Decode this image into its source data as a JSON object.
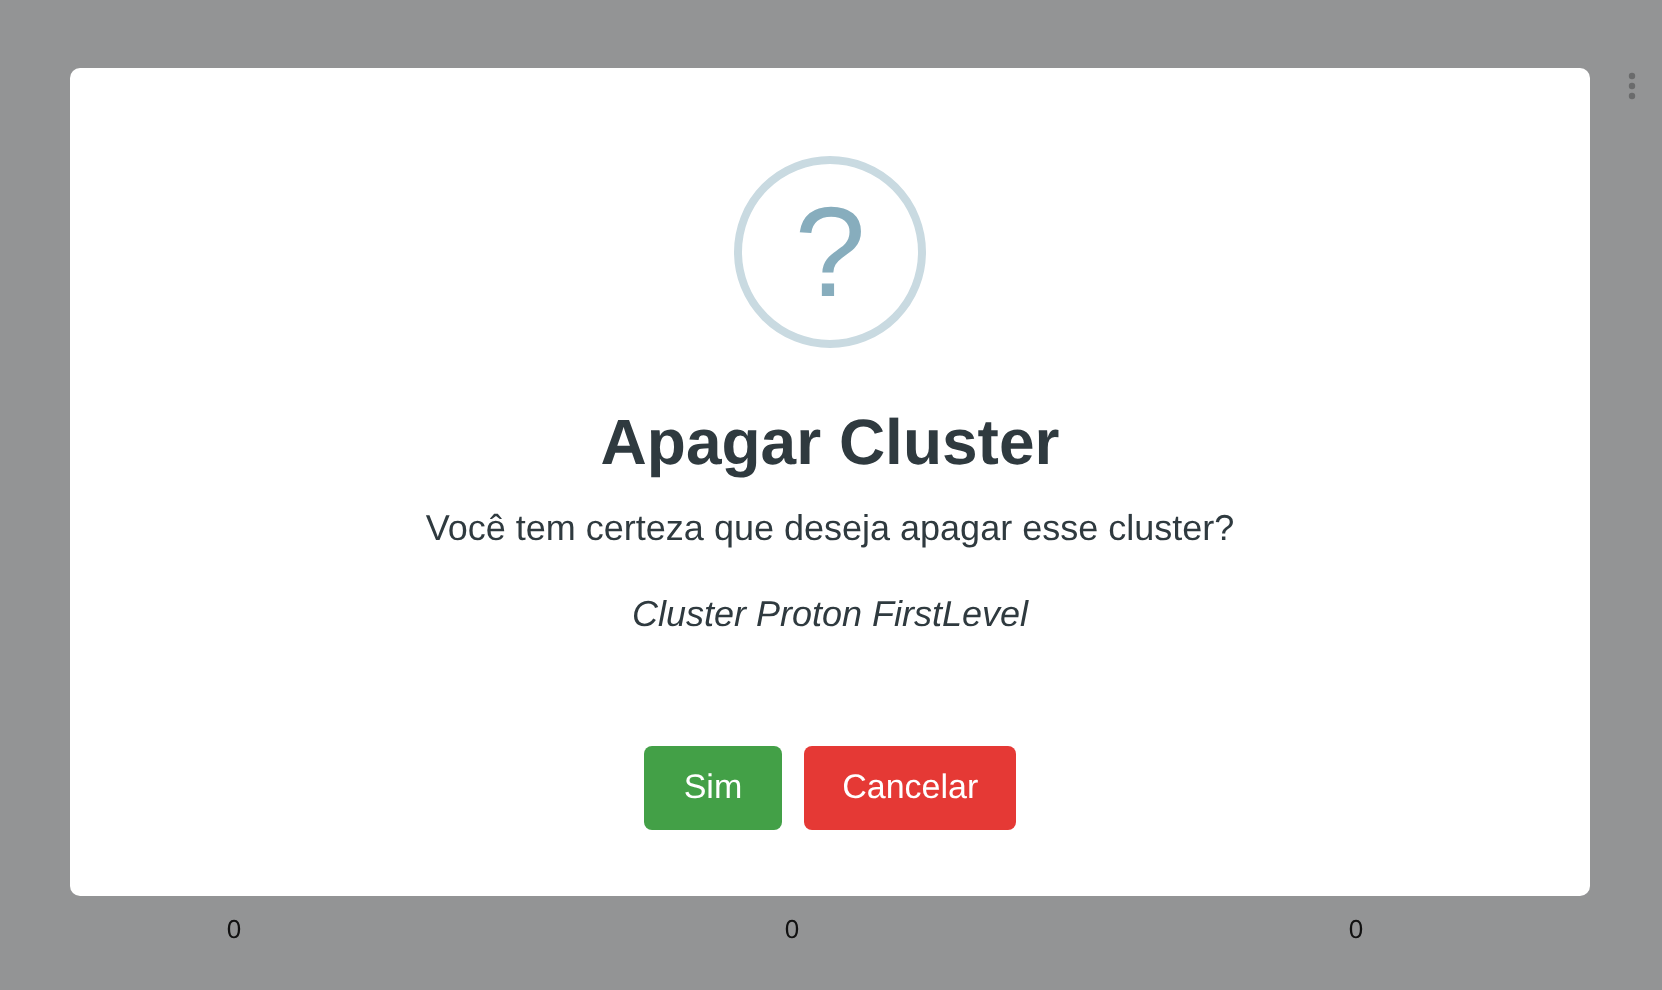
{
  "background_table": {
    "cells": [
      "0",
      "0",
      "0"
    ]
  },
  "dialog": {
    "icon": "?",
    "title": "Apagar Cluster",
    "message": "Você tem certeza que deseja apagar esse cluster?",
    "item": "Cluster Proton FirstLevel",
    "buttons": [
      {
        "label": "Sim",
        "kind": "confirm"
      },
      {
        "label": "Cancelar",
        "kind": "cancel"
      }
    ]
  }
}
